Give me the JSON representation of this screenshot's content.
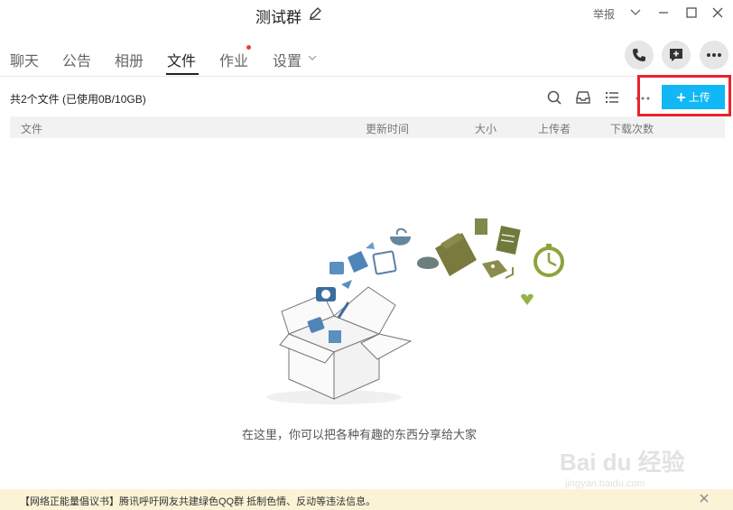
{
  "window": {
    "title": "测试群",
    "report_label": "举报"
  },
  "tabs": [
    {
      "label": "聊天"
    },
    {
      "label": "公告"
    },
    {
      "label": "相册"
    },
    {
      "label": "文件"
    },
    {
      "label": "作业"
    },
    {
      "label": "设置"
    }
  ],
  "toolbar": {
    "file_summary": "共2个文件 (已使用0B/10GB)",
    "upload_label": "上传"
  },
  "columns": [
    "文件",
    "更新时间",
    "大小",
    "上传者",
    "下载次数"
  ],
  "empty_state": {
    "message": "在这里，你可以把各种有趣的东西分享给大家"
  },
  "notice": {
    "text": "【网络正能量倡议书】腾讯呼吁网友共建绿色QQ群 抵制色情、反动等违法信息。"
  },
  "watermark": {
    "brand": "Bai du 经验",
    "url": "jingyan.baidu.com"
  },
  "colors": {
    "accent": "#12b7f5",
    "highlight_box": "#e8232b",
    "notice_bg": "#faf3d6"
  }
}
